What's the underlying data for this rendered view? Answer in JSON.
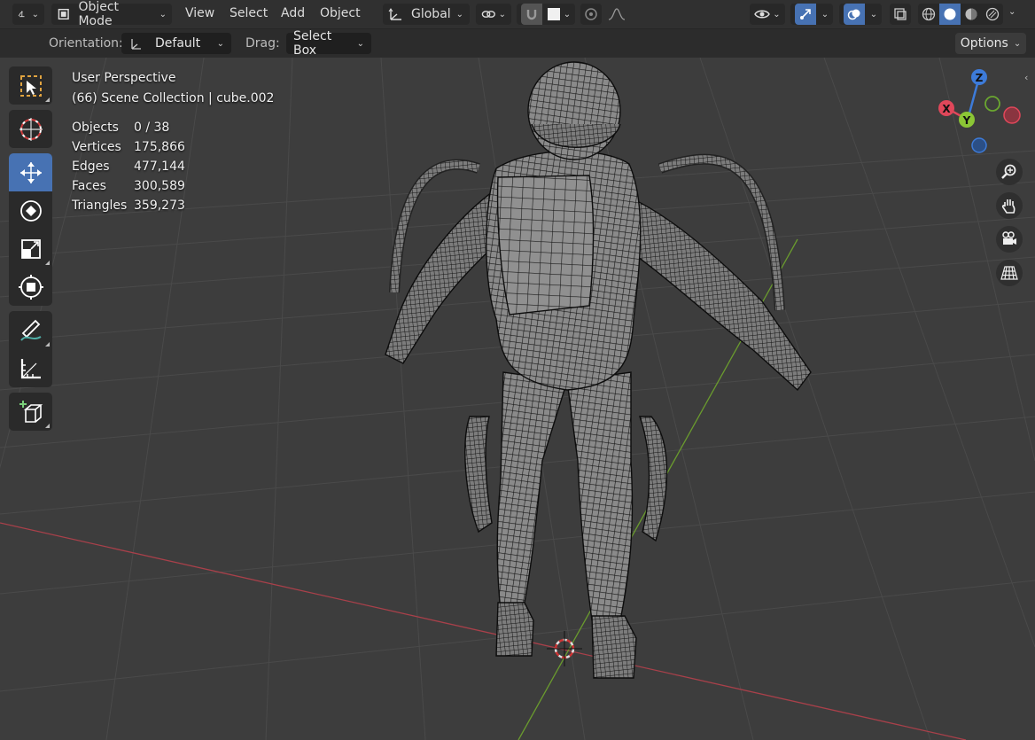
{
  "header": {
    "mode_label": "Object Mode",
    "menus": [
      "View",
      "Select",
      "Add",
      "Object"
    ],
    "transform_orientation": "Global",
    "options_label": "Options"
  },
  "toolsettings": {
    "orientation_label": "Orientation:",
    "orientation_value": "Default",
    "drag_label": "Drag:",
    "drag_value": "Select Box"
  },
  "overlay": {
    "view_name": "User Perspective",
    "collection_line": "(66) Scene Collection | cube.002",
    "stats": [
      {
        "key": "Objects",
        "value": "0 / 38"
      },
      {
        "key": "Vertices",
        "value": "175,866"
      },
      {
        "key": "Edges",
        "value": "477,144"
      },
      {
        "key": "Faces",
        "value": "300,589"
      },
      {
        "key": "Triangles",
        "value": "359,273"
      }
    ]
  },
  "gizmo": {
    "x_label": "X",
    "y_label": "Y",
    "z_label": "Z",
    "x_color": "#e0475a",
    "y_color": "#8bc635",
    "z_color": "#3d7bd9"
  },
  "colors": {
    "accent": "#4772b3",
    "x_axis_line": "#a8404a",
    "y_axis_line": "#6a9b2e"
  }
}
